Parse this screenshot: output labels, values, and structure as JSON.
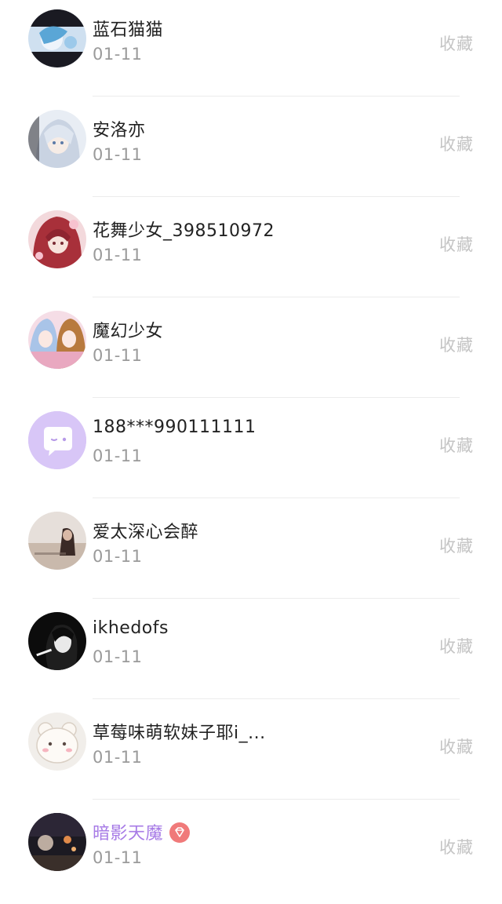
{
  "rows": [
    {
      "name": "蓝石猫猫",
      "date": "01-11",
      "action": "收藏",
      "avatar": "anime-avatar-blue"
    },
    {
      "name": "安洛亦",
      "date": "01-11",
      "action": "收藏",
      "avatar": "anime-avatar-white-hair"
    },
    {
      "name": "花舞少女_398510972",
      "date": "01-11",
      "action": "收藏",
      "avatar": "anime-avatar-red-hair"
    },
    {
      "name": "魔幻少女",
      "date": "01-11",
      "action": "收藏",
      "avatar": "anime-avatar-pair"
    },
    {
      "name": "188***990111111",
      "date": "01-11",
      "action": "收藏",
      "avatar": "default-chat-avatar"
    },
    {
      "name": "爱太深心会醉",
      "date": "01-11",
      "action": "收藏",
      "avatar": "photo-avatar-beach"
    },
    {
      "name": "ikhedofs",
      "date": "01-11",
      "action": "收藏",
      "avatar": "photo-avatar-bw"
    },
    {
      "name": "草莓味萌软妹子耶i_...",
      "date": "01-11",
      "action": "收藏",
      "avatar": "cute-bear-avatar"
    },
    {
      "name": "暗影天魔",
      "date": "01-11",
      "action": "收藏",
      "avatar": "dark-night-avatar",
      "vip": true
    }
  ],
  "colors": {
    "vip_name": "#a77be6",
    "vip_badge": "#f07a7a",
    "default_avatar_bg": "#d8c6f7"
  }
}
